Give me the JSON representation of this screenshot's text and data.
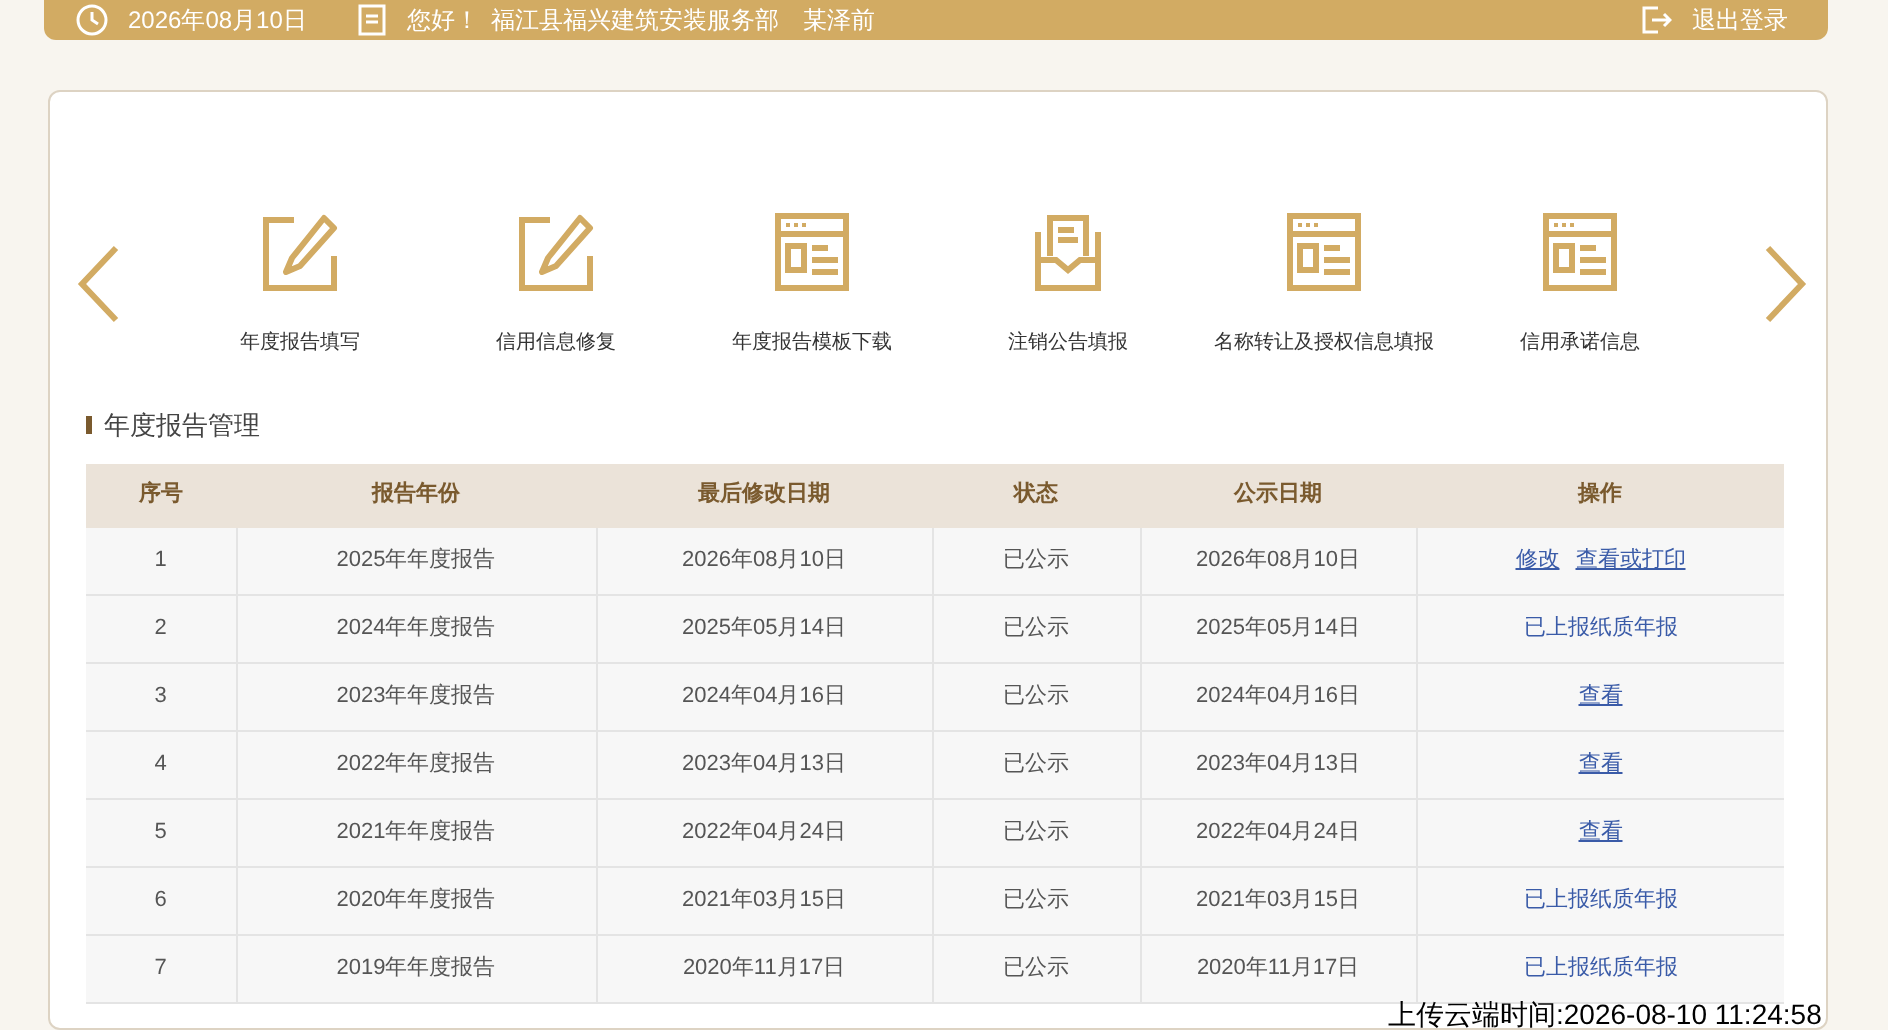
{
  "top_bar": {
    "date": "2026年08月10日",
    "greeting": "您好！",
    "company": "福江县福兴建筑安装服务部",
    "user": "某泽前",
    "logout": "退出登录"
  },
  "shortcuts": [
    {
      "kind": "edit",
      "label": "年度报告填写"
    },
    {
      "kind": "edit",
      "label": "信用信息修复"
    },
    {
      "kind": "form",
      "label": "年度报告模板下载"
    },
    {
      "kind": "inbox",
      "label": "注销公告填报"
    },
    {
      "kind": "form",
      "label": "名称转让及授权信息填报"
    },
    {
      "kind": "form",
      "label": "信用承诺信息"
    }
  ],
  "section_title": "年度报告管理",
  "table": {
    "columns": [
      "序号",
      "报告年份",
      "最后修改日期",
      "状态",
      "公示日期",
      "操作"
    ],
    "rows": [
      {
        "cells": [
          "1",
          "2025年年度报告",
          "2026年08月10日",
          "已公示",
          "2026年08月10日"
        ],
        "actions": [
          {
            "label": "修改",
            "underlined": true
          },
          {
            "label": "查看或打印",
            "underlined": true
          }
        ]
      },
      {
        "cells": [
          "2",
          "2024年年度报告",
          "2025年05月14日",
          "已公示",
          "2025年05月14日"
        ],
        "actions": [
          {
            "label": "已上报纸质年报",
            "underlined": false
          }
        ]
      },
      {
        "cells": [
          "3",
          "2023年年度报告",
          "2024年04月16日",
          "已公示",
          "2024年04月16日"
        ],
        "actions": [
          {
            "label": "查看",
            "underlined": true
          }
        ]
      },
      {
        "cells": [
          "4",
          "2022年年度报告",
          "2023年04月13日",
          "已公示",
          "2023年04月13日"
        ],
        "actions": [
          {
            "label": "查看",
            "underlined": true
          }
        ]
      },
      {
        "cells": [
          "5",
          "2021年年度报告",
          "2022年04月24日",
          "已公示",
          "2022年04月24日"
        ],
        "actions": [
          {
            "label": "查看",
            "underlined": true
          }
        ]
      },
      {
        "cells": [
          "6",
          "2020年年度报告",
          "2021年03月15日",
          "已公示",
          "2021年03月15日"
        ],
        "actions": [
          {
            "label": "已上报纸质年报",
            "underlined": false
          }
        ]
      },
      {
        "cells": [
          "7",
          "2019年年度报告",
          "2020年11月17日",
          "已公示",
          "2020年11月17日"
        ],
        "actions": [
          {
            "label": "已上报纸质年报",
            "underlined": false
          }
        ]
      }
    ]
  },
  "upload_stamp": "上传云端时间:2026-08-10 11:24:58"
}
